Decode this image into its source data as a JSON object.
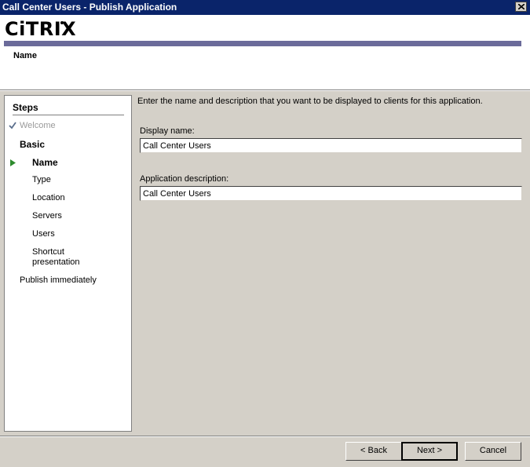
{
  "window": {
    "title": "Call Center Users - Publish Application"
  },
  "header": {
    "logo_text": "CiTRIX",
    "subtitle": "Name",
    "bar_color": "#6b6b9a"
  },
  "steps": {
    "heading": "Steps",
    "items": [
      {
        "label": "Welcome",
        "state": "done",
        "icon": "check-icon"
      },
      {
        "label": "Basic",
        "state": "group"
      },
      {
        "label": "Name",
        "state": "current",
        "icon": "arrow-right-icon"
      },
      {
        "label": "Type",
        "state": "pending"
      },
      {
        "label": "Location",
        "state": "pending"
      },
      {
        "label": "Servers",
        "state": "pending"
      },
      {
        "label": "Users",
        "state": "pending"
      },
      {
        "label": "Shortcut presentation",
        "state": "pending"
      },
      {
        "label": "Publish immediately",
        "state": "pending"
      }
    ]
  },
  "form": {
    "instruction": "Enter the name and description that you want to be displayed to clients for this application.",
    "display_name_label": "Display name:",
    "display_name_value": "Call Center Users",
    "description_label": "Application description:",
    "description_value": "Call Center Users"
  },
  "buttons": {
    "back": "< Back",
    "next": "Next >",
    "cancel": "Cancel"
  },
  "colors": {
    "title_bar": "#0a246a",
    "dialog_bg": "#d4d0c8",
    "current_step_arrow": "#2e8b2e"
  }
}
